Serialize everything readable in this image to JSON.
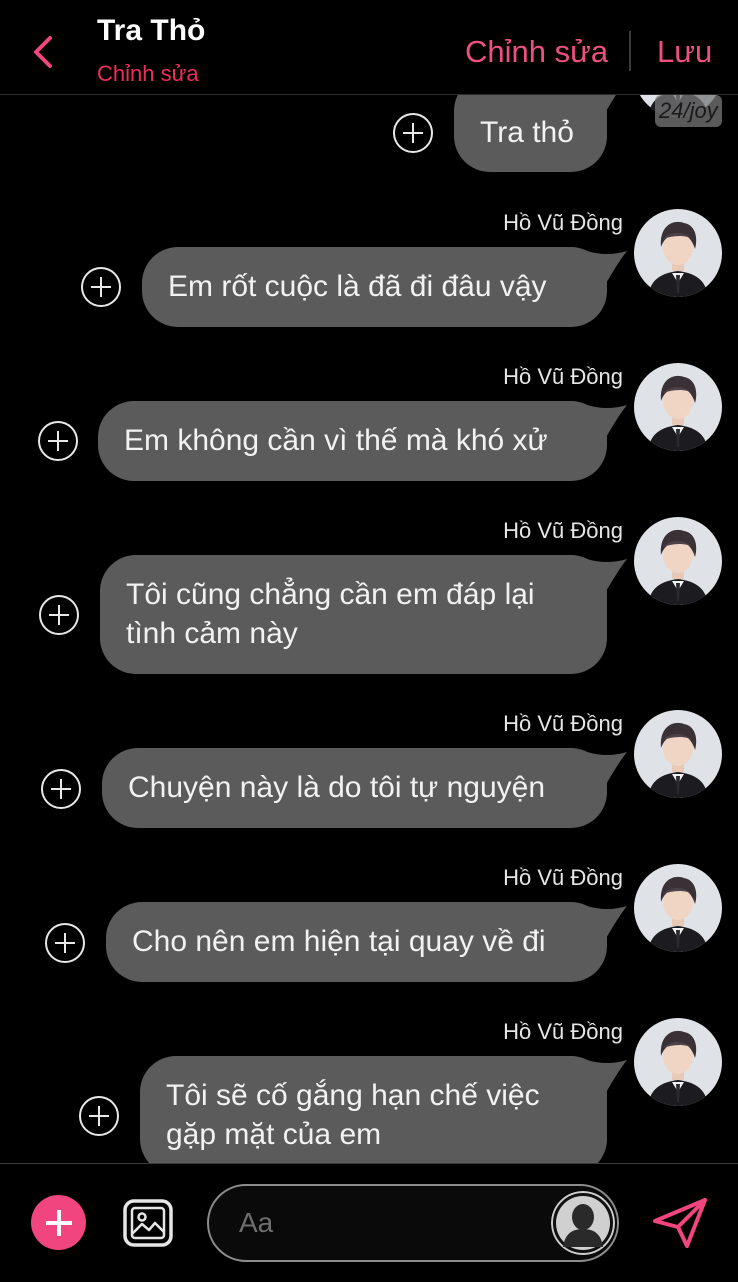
{
  "header": {
    "title": "Tra Thỏ",
    "subtitle": "Chỉnh sửa",
    "edit_label": "Chỉnh sửa",
    "save_label": "Lưu",
    "accent": "#ef4f80"
  },
  "first_message": {
    "text": "Tra thỏ",
    "watermark": "24/joy"
  },
  "messages": [
    {
      "sender": "Hồ Vũ Đồng",
      "text": "Em rốt cuộc là đã đi đâu vậy"
    },
    {
      "sender": "Hồ Vũ Đồng",
      "text": "Em không cần vì thế mà khó xử"
    },
    {
      "sender": "Hồ Vũ Đồng",
      "text": "Tôi cũng chẳng cần em đáp lại\ntình cảm này"
    },
    {
      "sender": "Hồ Vũ Đồng",
      "text": "Chuyện này là do tôi tự nguyện"
    },
    {
      "sender": "Hồ Vũ Đồng",
      "text": "Cho nên em hiện tại quay về đi"
    },
    {
      "sender": "Hồ Vũ Đồng",
      "text": "Tôi sẽ cố gắng hạn chế việc\ngặp mặt của em"
    }
  ],
  "composer": {
    "placeholder": "Aa"
  },
  "colors": {
    "bubble": "#5b5b5b",
    "add_button": "#f0457e"
  }
}
